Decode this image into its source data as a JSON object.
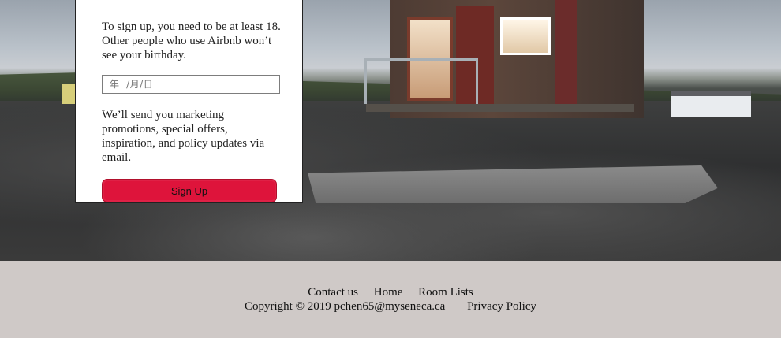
{
  "signup_card": {
    "age_notice": "To sign up, you need to be at least 18. Other people who use Airbnb won’t see your birthday.",
    "birthday_placeholder": "年  /月/日",
    "marketing_notice": "We’ll send you marketing promotions, special offers, inspiration, and policy updates via email.",
    "signup_label": "Sign Up"
  },
  "footer": {
    "links": [
      "Contact us",
      "Home",
      "Room Lists"
    ],
    "copyright": "Copyright © 2019 pchen65@myseneca.ca",
    "privacy_label": "Privacy Policy"
  },
  "colors": {
    "signup_button": "#de143b",
    "footer_bg": "#cfc9c7"
  }
}
